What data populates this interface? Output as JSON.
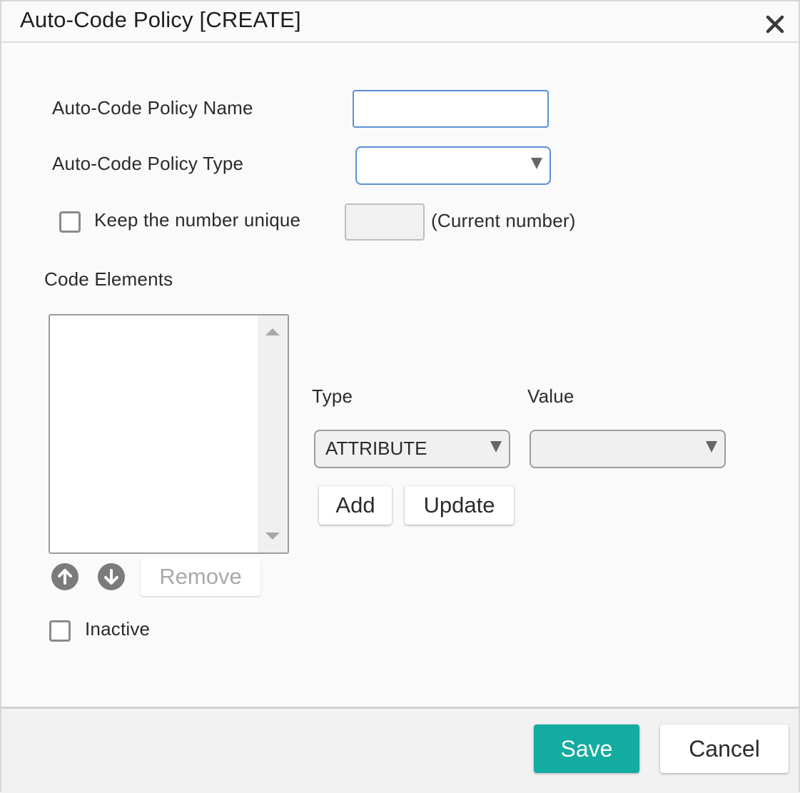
{
  "dialog": {
    "title": "Auto-Code Policy [CREATE]"
  },
  "form": {
    "policy_name_label": "Auto-Code Policy Name",
    "policy_name_value": "",
    "policy_type_label": "Auto-Code Policy Type",
    "policy_type_value": "",
    "keep_unique_label": "Keep the number unique",
    "keep_unique_checked": false,
    "current_number_value": "",
    "current_number_label": "(Current number)",
    "code_elements_label": "Code Elements",
    "code_elements_items": [],
    "type_label": "Type",
    "type_value": "ATTRIBUTE",
    "value_label": "Value",
    "value_value": "",
    "add_label": "Add",
    "update_label": "Update",
    "remove_label": "Remove",
    "inactive_label": "Inactive",
    "inactive_checked": false
  },
  "footer": {
    "save_label": "Save",
    "cancel_label": "Cancel"
  },
  "colors": {
    "accent": "#14aba0",
    "input_focus_border": "#5b8fd6"
  },
  "icons": {
    "close": "close-icon",
    "move_up": "arrow-up-circle-icon",
    "move_down": "arrow-down-circle-icon"
  }
}
